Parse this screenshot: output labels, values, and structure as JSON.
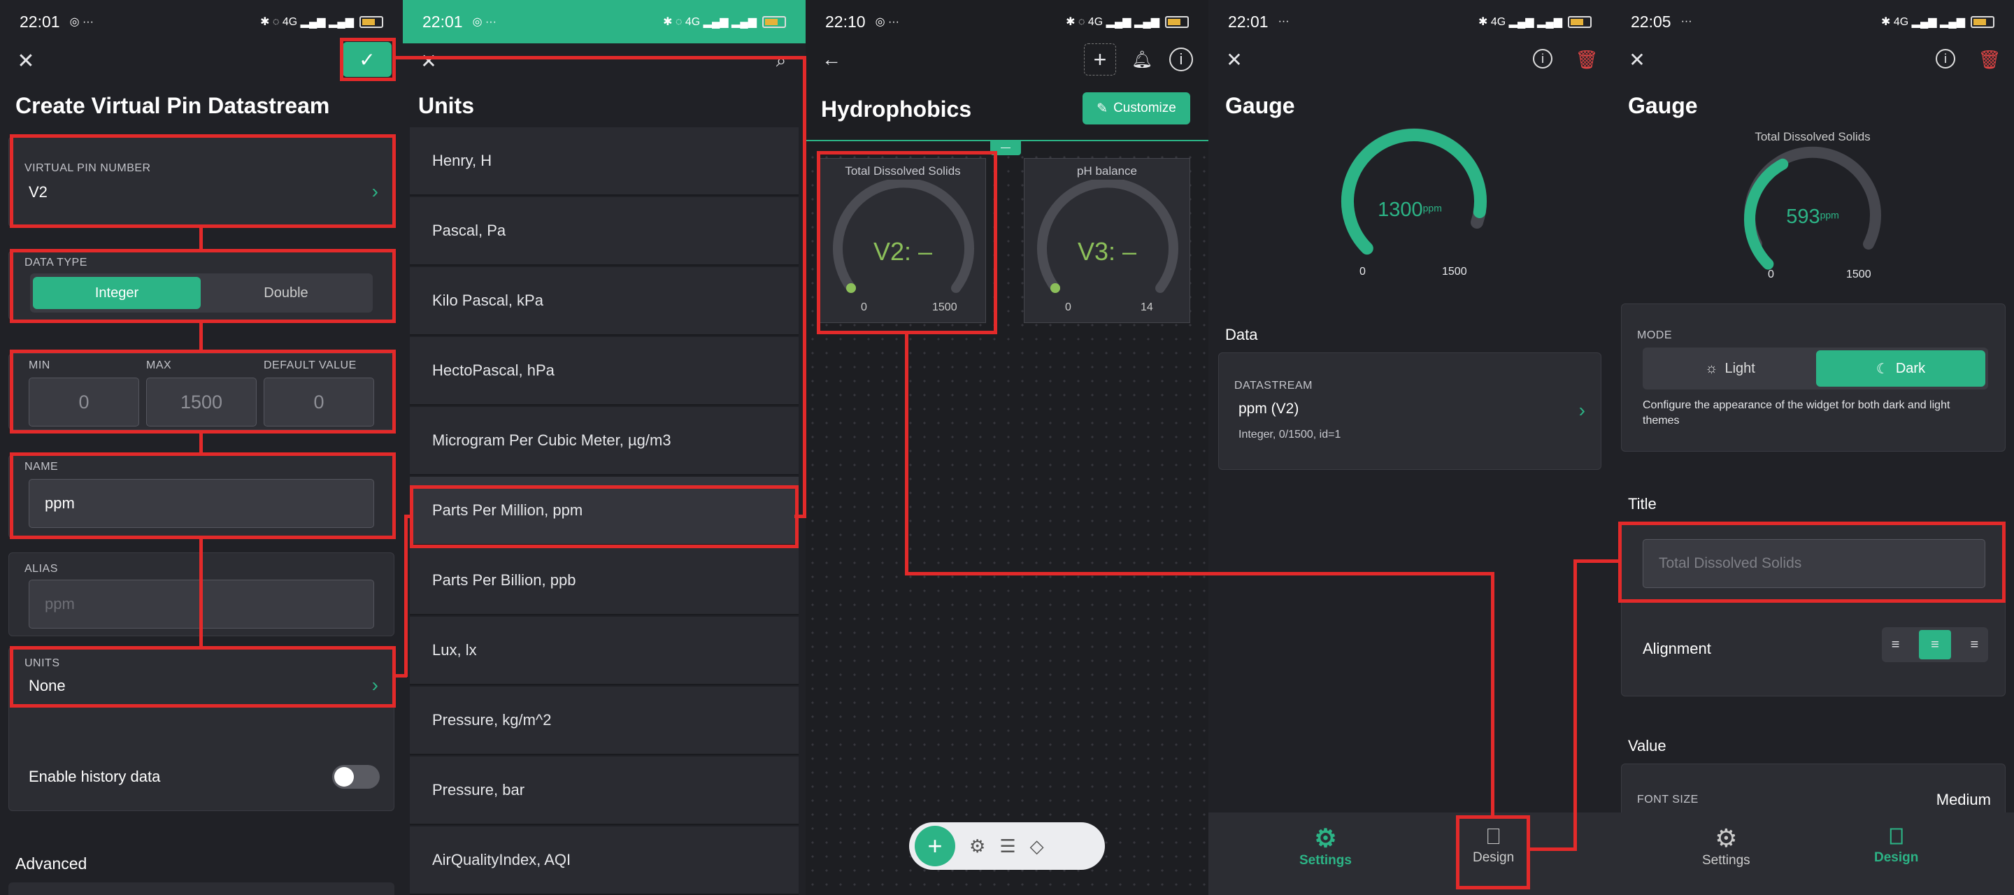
{
  "colors": {
    "accent": "#2cb486",
    "annotation": "#e32a2a",
    "bg": "#202126",
    "card": "#2c2d33"
  },
  "p1": {
    "status_time": "22:01",
    "title": "Create Virtual Pin Datastream",
    "vpin_label": "VIRTUAL PIN NUMBER",
    "vpin_value": "V2",
    "datatype_label": "DATA TYPE",
    "datatype_options": [
      "Integer",
      "Double"
    ],
    "datatype_selected": "Integer",
    "min_label": "MIN",
    "max_label": "MAX",
    "default_label": "DEFAULT VALUE",
    "min_value": "0",
    "max_value": "1500",
    "default_value": "0",
    "name_label": "NAME",
    "name_value": "ppm",
    "alias_label": "ALIAS",
    "alias_placeholder": "ppm",
    "units_label": "UNITS",
    "units_value": "None",
    "history_label": "Enable history data",
    "history_enabled": false,
    "advanced_label": "Advanced"
  },
  "p2": {
    "status_time": "22:01",
    "battery": "82",
    "title": "Units",
    "units": [
      "Henry, H",
      "Pascal, Pa",
      "Kilo Pascal, kPa",
      "HectoPascal, hPa",
      "Microgram Per Cubic Meter, µg/m3",
      "Parts Per Million, ppm",
      "Parts Per Billion, ppb",
      "Lux, lx",
      "Pressure, kg/m^2",
      "Pressure, bar",
      "AirQualityIndex, AQI"
    ],
    "selected": "Parts Per Million, ppm"
  },
  "p3": {
    "status_time": "22:10",
    "title": "Hydrophobics",
    "customize_label": "Customize",
    "gauges": [
      {
        "title": "Total Dissolved Solids",
        "value": "V2: –",
        "min": "0",
        "max": "1500"
      },
      {
        "title": "pH balance",
        "value": "V3: –",
        "min": "0",
        "max": "14"
      }
    ]
  },
  "p4": {
    "status_time": "22:01",
    "title": "Gauge",
    "gauge": {
      "value": "1300",
      "unit": "ppm",
      "min": "0",
      "max": "1500",
      "fraction": 0.867
    },
    "data_heading": "Data",
    "datastream_label": "DATASTREAM",
    "datastream_value": "ppm (V2)",
    "datastream_detail": "Integer, 0/1500, id=1",
    "tabs": [
      "Settings",
      "Design"
    ],
    "active_tab": "Settings"
  },
  "p5": {
    "status_time": "22:05",
    "title": "Gauge",
    "gauge": {
      "title": "Total Dissolved Solids",
      "value": "593",
      "unit": "ppm",
      "min": "0",
      "max": "1500",
      "fraction": 0.395
    },
    "mode_label": "MODE",
    "mode_options": [
      "Light",
      "Dark"
    ],
    "mode_selected": "Dark",
    "mode_help": "Configure the appearance of the widget for both dark and light themes",
    "title_heading": "Title",
    "title_placeholder": "Total Dissolved Solids",
    "alignment_label": "Alignment",
    "value_heading": "Value",
    "font_size_label": "FONT SIZE",
    "font_size_value": "Medium",
    "tabs": [
      "Settings",
      "Design"
    ],
    "active_tab": "Design"
  }
}
